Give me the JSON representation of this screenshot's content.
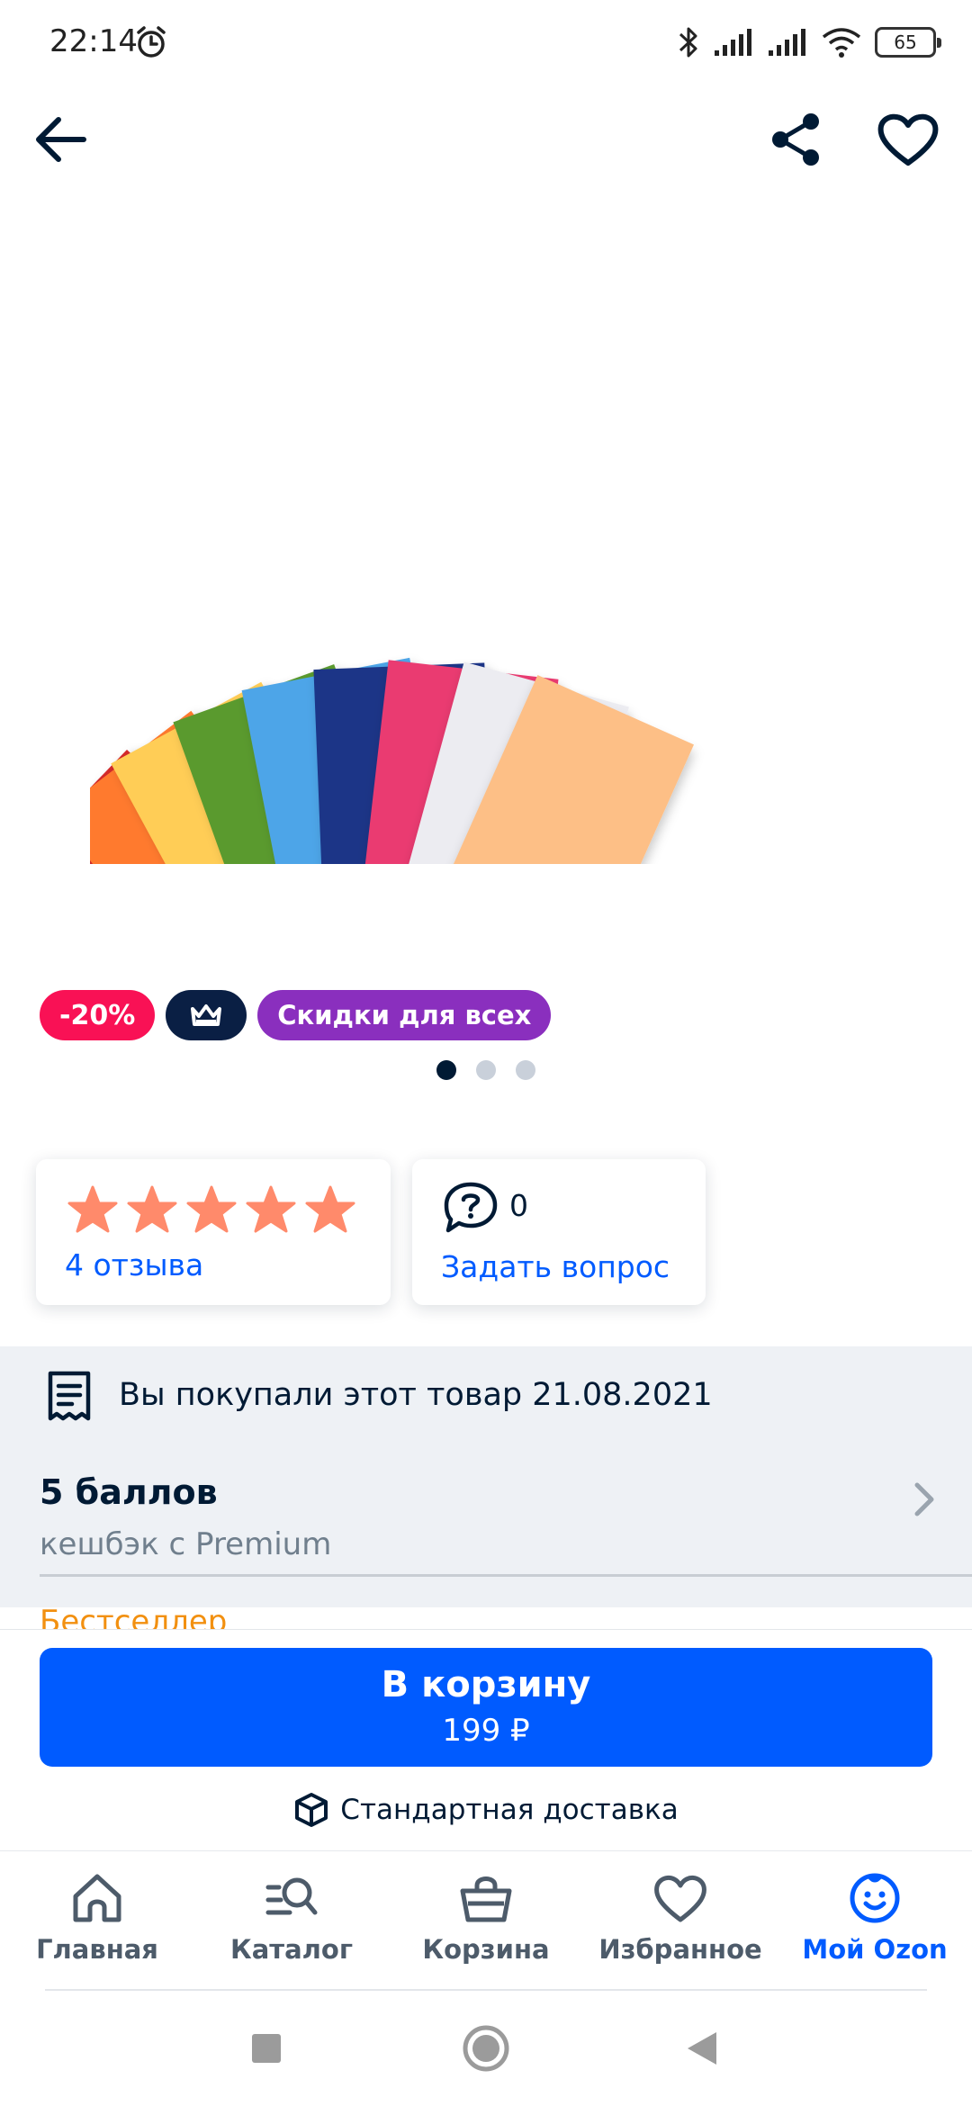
{
  "status_bar": {
    "time": "22:14",
    "battery": "65",
    "icons": [
      "alarm-icon",
      "bluetooth-icon",
      "signal-icon",
      "signal-icon",
      "wifi-icon",
      "battery-icon"
    ]
  },
  "header": {
    "back_icon": "arrow-left-icon",
    "share_icon": "share-icon",
    "favorite_icon": "heart-icon"
  },
  "product": {
    "image": "colored-paper-sheets",
    "sheet_colors": [
      "#d42a2a",
      "#ff7a2e",
      "#ffcd57",
      "#5a9a2f",
      "#4ea5e8",
      "#1f3487",
      "#ea3a71",
      "#ececf1",
      "#fdbf86"
    ]
  },
  "badges": {
    "discount": "-20%",
    "premium_icon": "crown-icon",
    "sale": "Скидки для всех"
  },
  "gallery": {
    "total": 3,
    "active": 0
  },
  "rating": {
    "stars": 5,
    "reviews_link": "4 отзыва"
  },
  "questions": {
    "count": "0",
    "ask_link": "Задать вопрос"
  },
  "purchase_info": {
    "text": "Вы покупали этот товар 21.08.2021"
  },
  "cashback": {
    "title": "5 баллов",
    "subtitle": "кешбэк с Premium"
  },
  "bestseller_label": "Бестселлер",
  "cart": {
    "button_label": "В корзину",
    "price": "199 ₽",
    "delivery": "Стандартная доставка"
  },
  "colors": {
    "accent": "#005bff",
    "discount": "#f91155",
    "sale": "#8a2fbe",
    "premium": "#0a1f44",
    "star": "#ff8a6b",
    "bestseller": "#f29010"
  },
  "nav": {
    "items": [
      {
        "label": "Главная",
        "icon": "home-icon"
      },
      {
        "label": "Каталог",
        "icon": "catalog-search-icon"
      },
      {
        "label": "Корзина",
        "icon": "basket-icon"
      },
      {
        "label": "Избранное",
        "icon": "heart-icon"
      },
      {
        "label": "Мой Ozon",
        "icon": "profile-face-icon",
        "active": true
      }
    ]
  }
}
